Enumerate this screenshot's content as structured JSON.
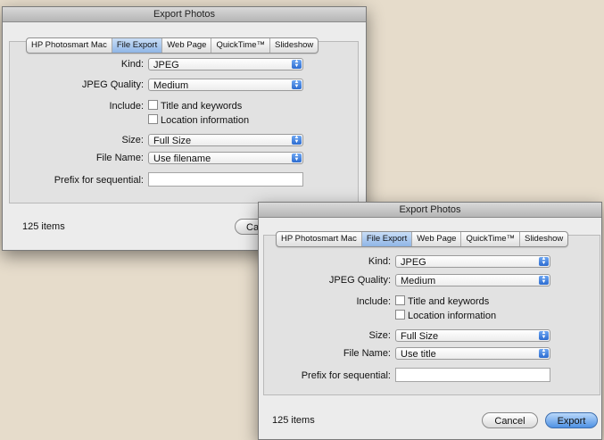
{
  "back_dialog": {
    "title": "Export Photos",
    "tabs": [
      "HP Photosmart Mac",
      "File Export",
      "Web Page",
      "QuickTime™",
      "Slideshow"
    ],
    "active_tab": "File Export",
    "kind_label": "Kind:",
    "kind_value": "JPEG",
    "quality_label": "JPEG Quality:",
    "quality_value": "Medium",
    "include_label": "Include:",
    "check_title": "Title and keywords",
    "check_location": "Location information",
    "size_label": "Size:",
    "size_value": "Full Size",
    "filename_label": "File Name:",
    "filename_value": "Use filename",
    "prefix_label": "Prefix for sequential:",
    "prefix_value": "",
    "item_count": "125 items",
    "cancel_partial": "Ca"
  },
  "front_dialog": {
    "title": "Export Photos",
    "tabs": [
      "HP Photosmart Mac",
      "File Export",
      "Web Page",
      "QuickTime™",
      "Slideshow"
    ],
    "active_tab": "File Export",
    "kind_label": "Kind:",
    "kind_value": "JPEG",
    "quality_label": "JPEG Quality:",
    "quality_value": "Medium",
    "include_label": "Include:",
    "check_title": "Title and keywords",
    "check_location": "Location information",
    "size_label": "Size:",
    "size_value": "Full Size",
    "filename_label": "File Name:",
    "filename_value": "Use title",
    "prefix_label": "Prefix for sequential:",
    "prefix_value": "",
    "item_count": "125 items",
    "cancel_label": "Cancel",
    "export_label": "Export"
  },
  "colors": {
    "background": "#e6dccb",
    "active_tab": "#8fb5e6",
    "accent": "#2c6cd0"
  }
}
